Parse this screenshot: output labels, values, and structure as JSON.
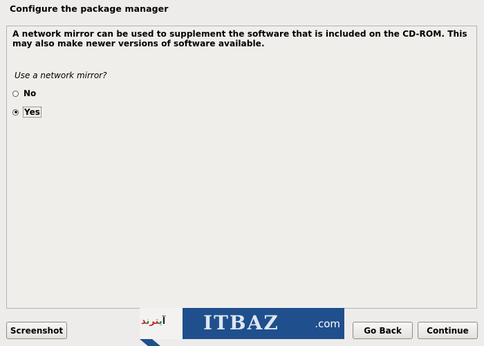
{
  "header": {
    "title": "Configure the package manager"
  },
  "content": {
    "description": "A network mirror can be used to supplement the software that is included on the CD-ROM. This may also make newer versions of software available.",
    "question": "Use a network mirror?",
    "options": [
      {
        "label": "No",
        "selected": false
      },
      {
        "label": "Yes",
        "selected": true
      }
    ]
  },
  "buttons": {
    "screenshot": "Screenshot",
    "go_back": "Go Back",
    "continue": "Continue"
  },
  "watermark": {
    "brand_text": "ITBAZ",
    "domain_suffix": ".com",
    "colors": {
      "blue": "#1f4f8c",
      "red": "#c0262d",
      "green": "#1a8a3a"
    }
  },
  "theme": {
    "background": "#edeceb",
    "panel_border": "#b5b3ae"
  }
}
